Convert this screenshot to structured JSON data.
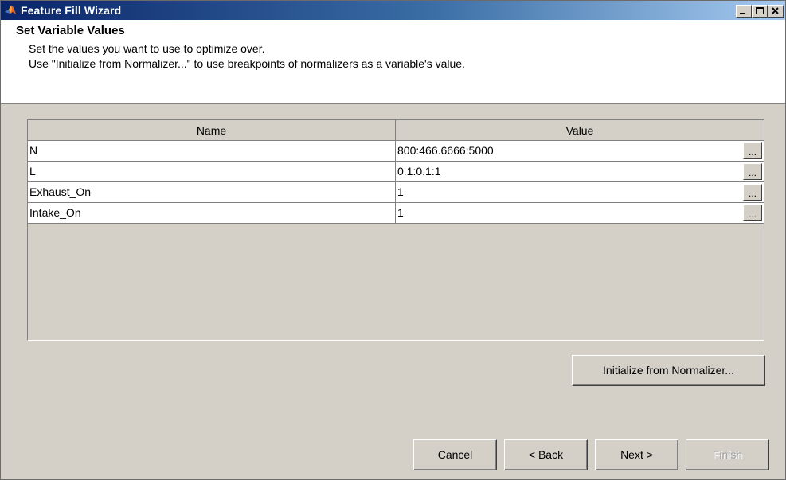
{
  "window": {
    "title": "Feature Fill Wizard",
    "icon": "matlab-icon",
    "caption_buttons": {
      "minimize": "minimize-icon",
      "maximize": "maximize-icon",
      "close": "close-icon"
    }
  },
  "header": {
    "title": "Set Variable Values",
    "line1": "Set the values you want to use to optimize over.",
    "line2": "Use \"Initialize from Normalizer...\" to use breakpoints of normalizers as a variable's value."
  },
  "table": {
    "columns": [
      "Name",
      "Value"
    ],
    "rows": [
      {
        "name": "N",
        "value": "800:466.6666:5000",
        "button": "..."
      },
      {
        "name": "L",
        "value": "0.1:0.1:1",
        "button": "..."
      },
      {
        "name": "Exhaust_On",
        "value": "1",
        "button": "..."
      },
      {
        "name": "Intake_On",
        "value": "1",
        "button": "..."
      }
    ]
  },
  "actions": {
    "initialize_label": "Initialize from Normalizer...",
    "cancel_label": "Cancel",
    "back_label": "< Back",
    "next_label": "Next >",
    "finish_label": "Finish",
    "finish_enabled": false
  },
  "colors": {
    "titlebar_start": "#0a246a",
    "titlebar_end": "#a6caf0",
    "face": "#d4d0c8",
    "disabled_text": "#a0a0a0"
  }
}
